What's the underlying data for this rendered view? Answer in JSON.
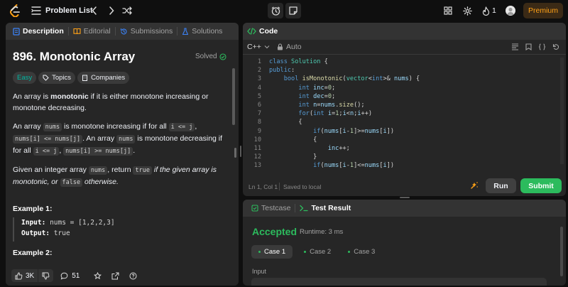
{
  "topbar": {
    "problem_list": "Problem List",
    "streak_count": "1",
    "premium": "Premium"
  },
  "left_tabs": {
    "description": "Description",
    "editorial": "Editorial",
    "submissions": "Submissions",
    "solutions": "Solutions"
  },
  "problem": {
    "title": "896. Monotonic Array",
    "status": "Solved",
    "difficulty": "Easy",
    "topics": "Topics",
    "companies": "Companies",
    "p1_a": "An array is ",
    "p1_b": "monotonic",
    "p1_c": " if it is either monotone increasing or monotone decreasing.",
    "p2_a": "An array ",
    "p2_b": "nums",
    "p2_c": " is monotone increasing if for all ",
    "p2_d": "i <= j",
    "p2_e": ", ",
    "p2_f": "nums[i] <= nums[j]",
    "p2_g": ". An array ",
    "p2_h": "nums",
    "p2_i": " is monotone decreasing if for all ",
    "p2_j": "i <= j",
    "p2_k": ", ",
    "p2_l": "nums[i] >= nums[j]",
    "p2_m": ".",
    "p3_a": "Given an integer array ",
    "p3_b": "nums",
    "p3_c": ", return ",
    "p3_d": "true",
    "p3_e": " if the given array is monotonic, or ",
    "p3_f": "false",
    "p3_g": " otherwise.",
    "ex1_title": "Example 1:",
    "ex1_input_label": "Input:",
    "ex1_input": "nums = [1,2,2,3]",
    "ex1_output_label": "Output:",
    "ex1_output": "true",
    "ex2_title": "Example 2:"
  },
  "footer": {
    "likes": "3K",
    "comments": "51"
  },
  "code_panel": {
    "title": "Code",
    "language": "C++",
    "auto": "Auto",
    "status_pos": "Ln 1, Col 1",
    "status_saved": "Saved to local",
    "run": "Run",
    "submit": "Submit",
    "lines": [
      {
        "n": "1",
        "t": [
          [
            "kw",
            "class "
          ],
          [
            "ty",
            "Solution "
          ],
          [
            "tx",
            "{"
          ]
        ]
      },
      {
        "n": "2",
        "t": [
          [
            "kw",
            "public"
          ],
          [
            "tx",
            ":"
          ]
        ]
      },
      {
        "n": "3",
        "t": [
          [
            "tx",
            "    "
          ],
          [
            "kw",
            "bool "
          ],
          [
            "fn",
            "isMonotonic"
          ],
          [
            "tx",
            "("
          ],
          [
            "ty",
            "vector"
          ],
          [
            "tx",
            "<"
          ],
          [
            "kw",
            "int"
          ],
          [
            "tx",
            ">& "
          ],
          [
            "vr",
            "nums"
          ],
          [
            "tx",
            ") {"
          ]
        ]
      },
      {
        "n": "4",
        "t": [
          [
            "tx",
            "        "
          ],
          [
            "kw",
            "int "
          ],
          [
            "vr",
            "inc"
          ],
          [
            "tx",
            "="
          ],
          [
            "nm",
            "0"
          ],
          [
            "tx",
            ";"
          ]
        ]
      },
      {
        "n": "5",
        "t": [
          [
            "tx",
            "        "
          ],
          [
            "kw",
            "int "
          ],
          [
            "vr",
            "dec"
          ],
          [
            "tx",
            "="
          ],
          [
            "nm",
            "0"
          ],
          [
            "tx",
            ";"
          ]
        ]
      },
      {
        "n": "6",
        "t": [
          [
            "tx",
            "        "
          ],
          [
            "kw",
            "int "
          ],
          [
            "vr",
            "n"
          ],
          [
            "tx",
            "="
          ],
          [
            "vr",
            "nums"
          ],
          [
            "tx",
            "."
          ],
          [
            "fn",
            "size"
          ],
          [
            "tx",
            "();"
          ]
        ]
      },
      {
        "n": "7",
        "t": [
          [
            "tx",
            "        "
          ],
          [
            "kw",
            "for"
          ],
          [
            "tx",
            "("
          ],
          [
            "kw",
            "int "
          ],
          [
            "vr",
            "i"
          ],
          [
            "tx",
            "="
          ],
          [
            "nm",
            "1"
          ],
          [
            "tx",
            ";"
          ],
          [
            "vr",
            "i"
          ],
          [
            "tx",
            "<"
          ],
          [
            "vr",
            "n"
          ],
          [
            "tx",
            ";"
          ],
          [
            "vr",
            "i"
          ],
          [
            "tx",
            "++)"
          ]
        ]
      },
      {
        "n": "8",
        "t": [
          [
            "tx",
            "        {"
          ]
        ]
      },
      {
        "n": "9",
        "t": [
          [
            "tx",
            "            "
          ],
          [
            "kw",
            "if"
          ],
          [
            "tx",
            "("
          ],
          [
            "vr",
            "nums"
          ],
          [
            "tx",
            "["
          ],
          [
            "vr",
            "i"
          ],
          [
            "tx",
            "-"
          ],
          [
            "nm",
            "1"
          ],
          [
            "tx",
            "]>="
          ],
          [
            "vr",
            "nums"
          ],
          [
            "tx",
            "["
          ],
          [
            "vr",
            "i"
          ],
          [
            "tx",
            "])"
          ]
        ]
      },
      {
        "n": "10",
        "t": [
          [
            "tx",
            "            {"
          ]
        ]
      },
      {
        "n": "11",
        "t": [
          [
            "tx",
            "                "
          ],
          [
            "vr",
            "inc"
          ],
          [
            "tx",
            "++;"
          ]
        ]
      },
      {
        "n": "12",
        "t": [
          [
            "tx",
            "            }"
          ]
        ]
      },
      {
        "n": "13",
        "t": [
          [
            "tx",
            "            "
          ],
          [
            "kw",
            "if"
          ],
          [
            "tx",
            "("
          ],
          [
            "vr",
            "nums"
          ],
          [
            "tx",
            "["
          ],
          [
            "vr",
            "i"
          ],
          [
            "tx",
            "-"
          ],
          [
            "nm",
            "1"
          ],
          [
            "tx",
            "]<="
          ],
          [
            "vr",
            "nums"
          ],
          [
            "tx",
            "["
          ],
          [
            "vr",
            "i"
          ],
          [
            "tx",
            "])"
          ]
        ]
      }
    ]
  },
  "result_panel": {
    "testcase": "Testcase",
    "test_result": "Test Result",
    "accepted": "Accepted",
    "runtime": "Runtime: 3 ms",
    "cases": [
      "Case 1",
      "Case 2",
      "Case 3"
    ],
    "input_label": "Input"
  },
  "colors": {
    "accepted": "#2cbb5d",
    "easy": "#00b8a3",
    "premium": "#ffa116",
    "submit": "#2cbb5d"
  }
}
